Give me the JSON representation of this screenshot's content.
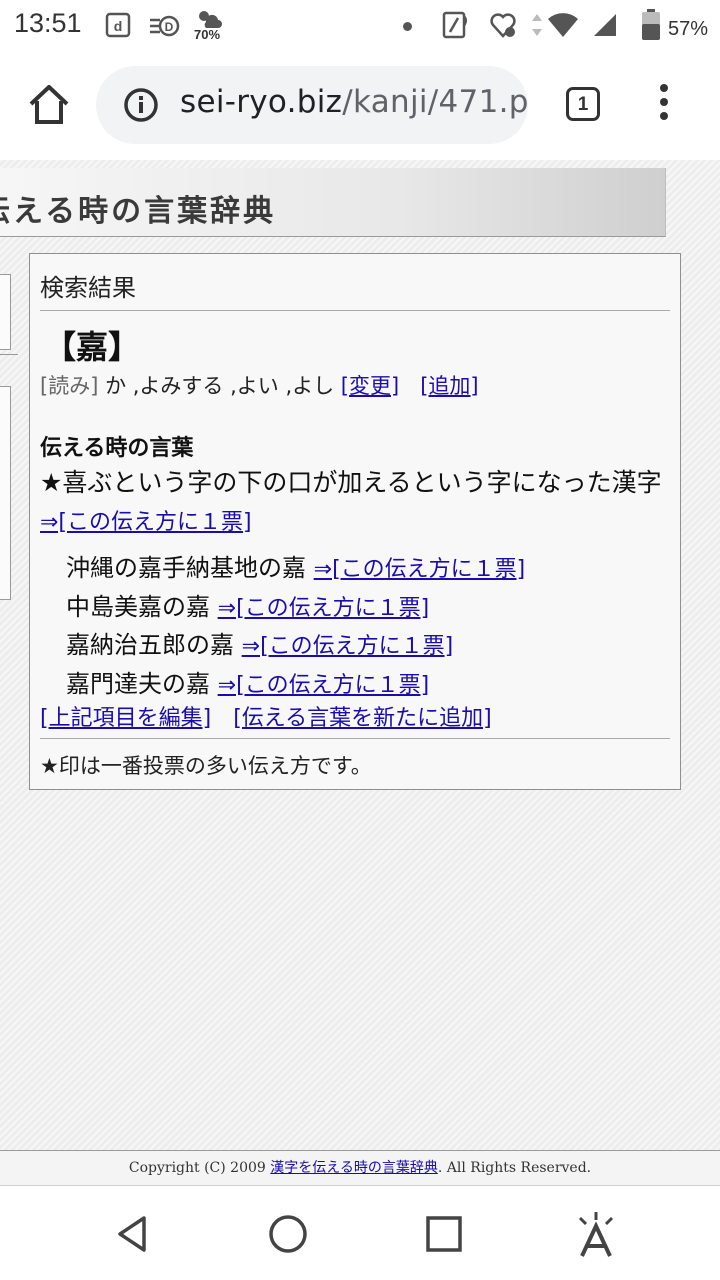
{
  "status": {
    "time": "13:51",
    "badge_percent": "70%",
    "battery": "57%"
  },
  "browser": {
    "url_host": "sei-ryo.biz",
    "url_path": "/kanji/471.p",
    "tab_count": "1"
  },
  "site": {
    "banner_title": "伝える時の言葉辞典"
  },
  "result": {
    "heading": "検索結果",
    "kanji": "【嘉】",
    "reading_label": "[読み]",
    "reading_value": " か ,よみする ,よい ,よし ",
    "change_link": "[変更]",
    "add_link": "[追加]",
    "section_title": "伝える時の言葉",
    "star_text": "★喜ぶという字の下の口が加えるという字になった漢字 ",
    "vote_link": "⇒[この伝え方に１票]",
    "items": [
      "沖縄の嘉手納基地の嘉 ",
      "中島美嘉の嘉 ",
      "嘉納治五郎の嘉 ",
      "嘉門達夫の嘉 "
    ],
    "edit_link": "[上記項目を編集]",
    "new_link": "[伝える言葉を新たに追加]",
    "footnote": "★印は一番投票の多い伝え方です。"
  },
  "footer": {
    "copyright": "Copyright (C) 2009 ",
    "site_link": "漢字を伝える時の言葉辞典",
    "rights": ". All Rights Reserved."
  }
}
